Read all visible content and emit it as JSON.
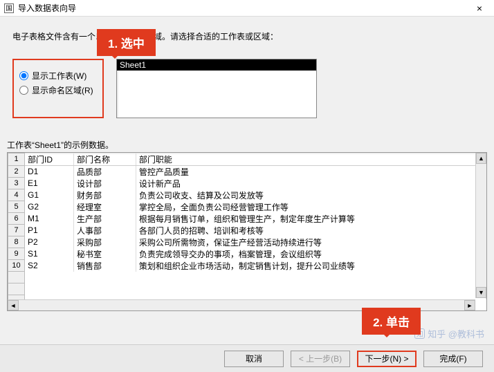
{
  "titlebar": {
    "icon_label": "国",
    "title": "导入数据表向导",
    "close": "×"
  },
  "instruction": "电子表格文件含有一个以上工作表或区域。请选择合适的工作表或区域：",
  "callouts": {
    "c1": "1. 选中",
    "c2": "2. 单击"
  },
  "radios": {
    "show_worksheets": "显示工作表(W)",
    "show_named_ranges": "显示命名区域(R)"
  },
  "listbox": {
    "items": [
      "Sheet1"
    ]
  },
  "sample_label": "工作表“Sheet1”的示例数据。",
  "table": {
    "headers": [
      "部门ID",
      "部门名称",
      "部门职能"
    ],
    "rows": [
      [
        "D1",
        "品质部",
        "管控产品质量"
      ],
      [
        "E1",
        "设计部",
        "设计新产品"
      ],
      [
        "G1",
        "财务部",
        "负责公司收支、结算及公司发放等"
      ],
      [
        "G2",
        "经理室",
        "掌控全局，全面负责公司经营管理工作等"
      ],
      [
        "M1",
        "生产部",
        "根据每月销售订单，组织和管理生产，制定年度生产计算等"
      ],
      [
        "P1",
        "人事部",
        "各部门人员的招聘、培训和考核等"
      ],
      [
        "P2",
        "采购部",
        "采购公司所需物资，保证生产经营活动持续进行等"
      ],
      [
        "S1",
        "秘书室",
        "负责完成领导交办的事项，档案管理，会议组织等"
      ],
      [
        "S2",
        "销售部",
        "策划和组织企业市场活动，制定销售计划，提升公司业绩等"
      ]
    ]
  },
  "buttons": {
    "cancel": "取消",
    "back": "< 上一步(B)",
    "next": "下一步(N) >",
    "finish": "完成(F)"
  },
  "watermark": {
    "logo": "知",
    "text": "知乎 @教科书"
  }
}
